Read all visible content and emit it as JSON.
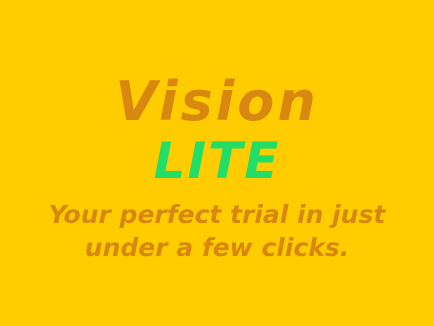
{
  "splash": {
    "brand_name": "Vision",
    "brand_edition": "LITE",
    "tagline": "Your perfect trial in just under a few clicks."
  },
  "colors": {
    "background": "#ffcc00",
    "brand_name": "#d9880f",
    "brand_edition": "#22dd66",
    "tagline": "#d9880f"
  }
}
